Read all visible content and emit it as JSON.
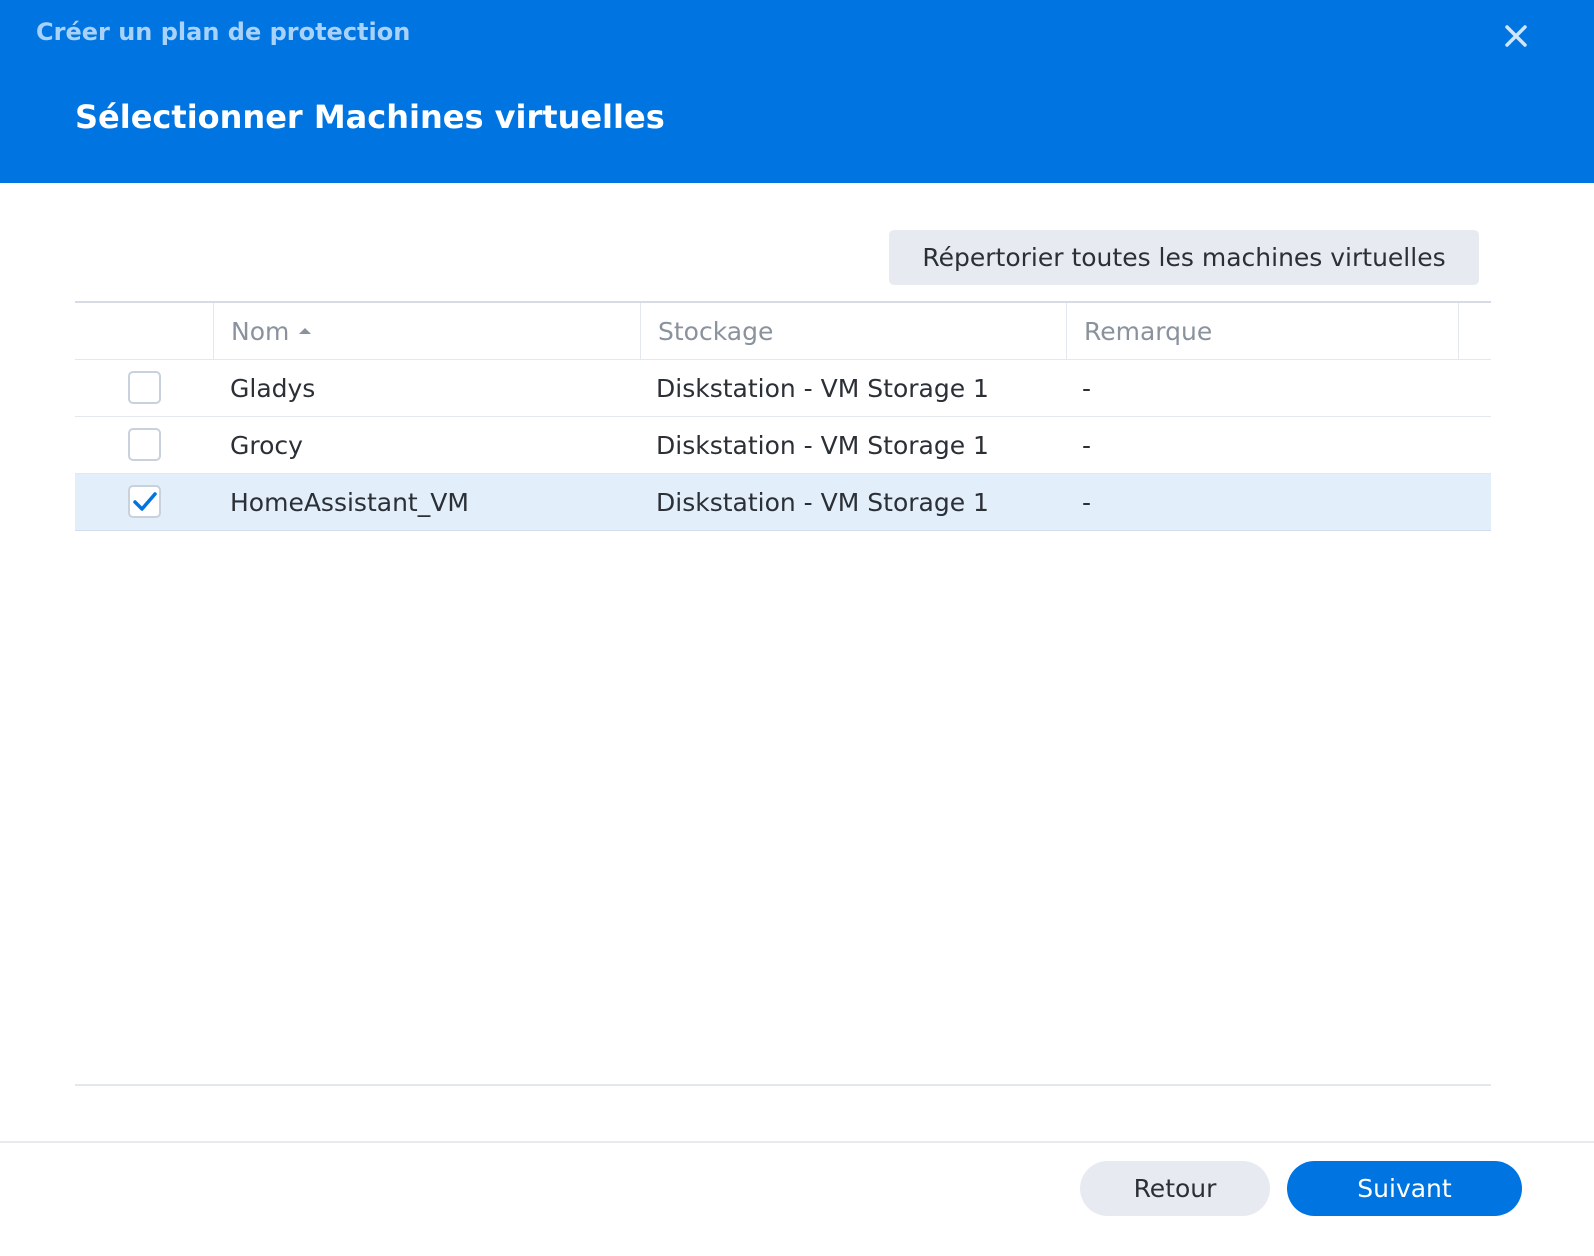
{
  "window": {
    "title": "Créer un plan de protection",
    "close_icon": "close-icon"
  },
  "step": {
    "title": "Sélectionner Machines virtuelles"
  },
  "toolbar": {
    "list_all_label": "Répertorier toutes les machines virtuelles"
  },
  "table": {
    "columns": [
      {
        "label": "Nom",
        "sorted": "ascending"
      },
      {
        "label": "Stockage"
      },
      {
        "label": "Remarque"
      }
    ],
    "rows": [
      {
        "checked": false,
        "name": "Gladys",
        "storage": "Diskstation - VM Storage 1",
        "remark": "-"
      },
      {
        "checked": false,
        "name": "Grocy",
        "storage": "Diskstation - VM Storage 1",
        "remark": "-"
      },
      {
        "checked": true,
        "name": "HomeAssistant_VM",
        "storage": "Diskstation - VM Storage 1",
        "remark": "-"
      }
    ]
  },
  "footer": {
    "back_label": "Retour",
    "next_label": "Suivant"
  },
  "colors": {
    "accent": "#0075e1",
    "selected_row": "#e2eefa"
  }
}
